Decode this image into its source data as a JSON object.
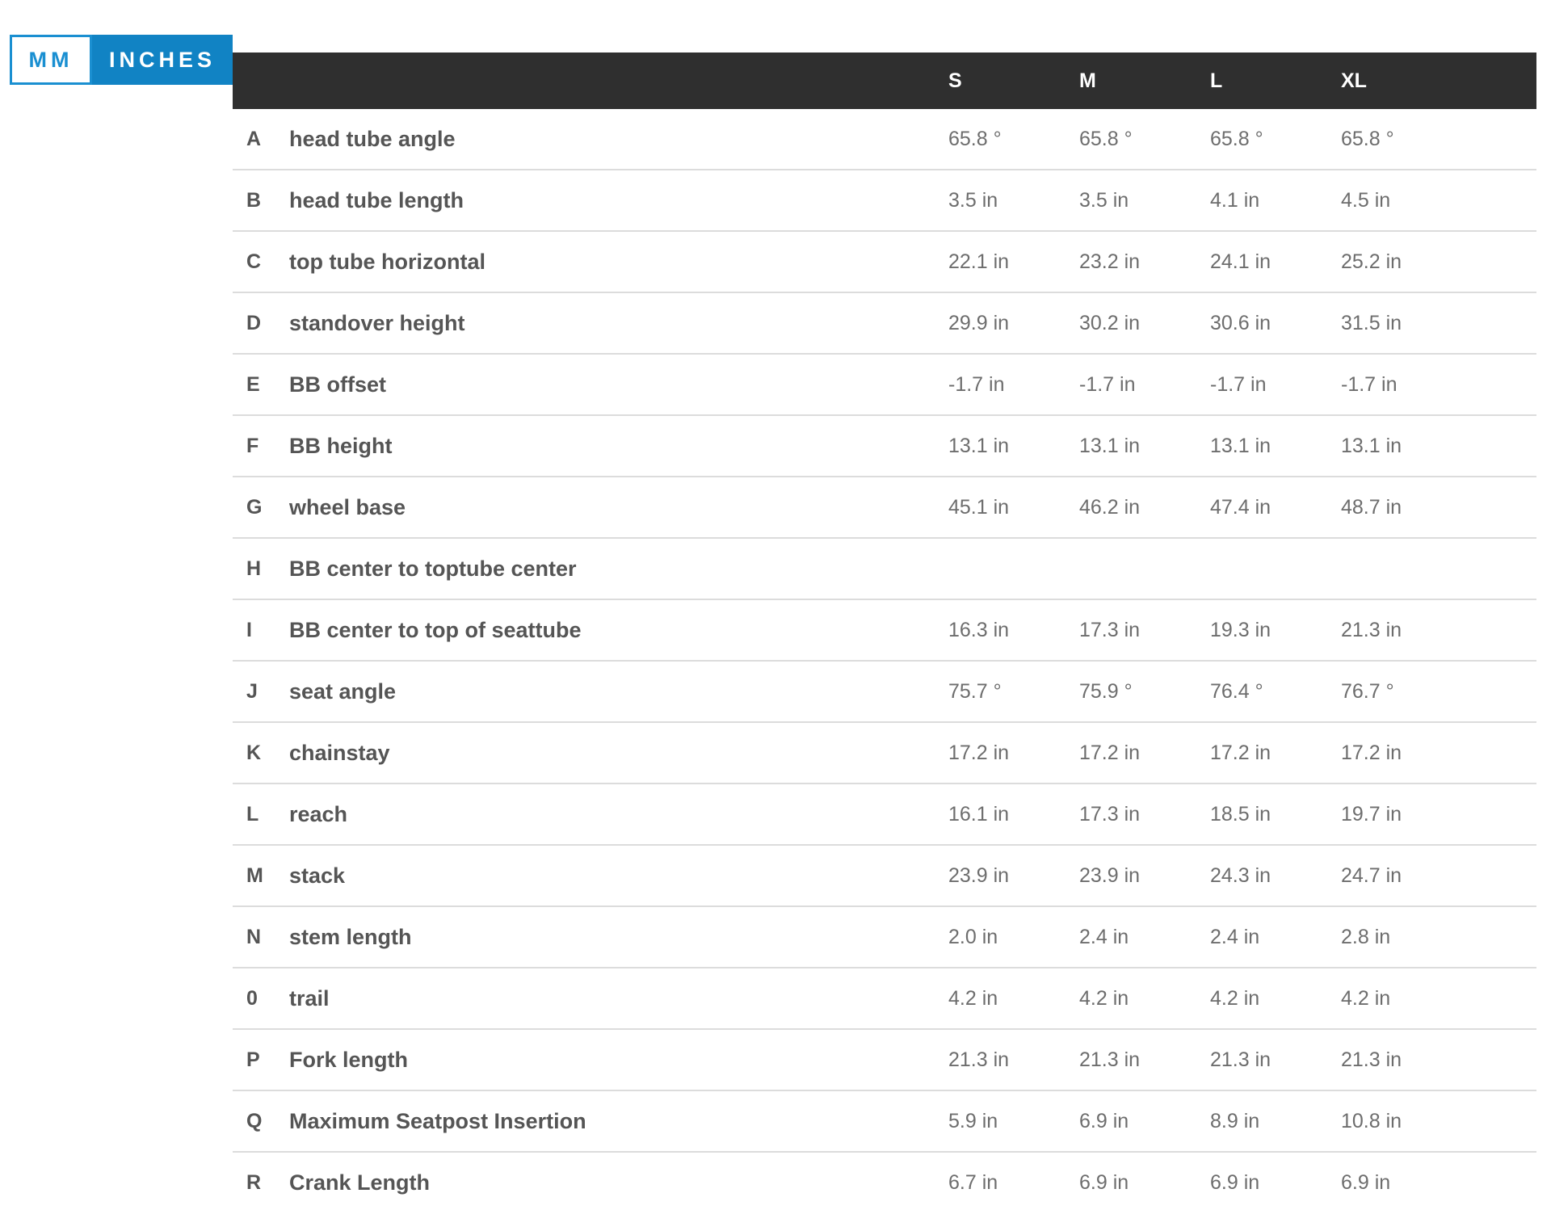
{
  "unit_toggle": {
    "mm_label": "MM",
    "inches_label": "INCHES",
    "active": "INCHES"
  },
  "colors": {
    "accent": "#1183c4",
    "header_bg": "#2f2f2f",
    "text": "#555555",
    "divider": "#dcdcdc"
  },
  "table": {
    "sizes": [
      "S",
      "M",
      "L",
      "XL"
    ],
    "rows": [
      {
        "letter": "A",
        "name": "head tube angle",
        "values": [
          "65.8 °",
          "65.8 °",
          "65.8 °",
          "65.8 °"
        ]
      },
      {
        "letter": "B",
        "name": "head tube length",
        "values": [
          "3.5 in",
          "3.5 in",
          "4.1 in",
          "4.5 in"
        ]
      },
      {
        "letter": "C",
        "name": "top tube horizontal",
        "values": [
          "22.1 in",
          "23.2 in",
          "24.1 in",
          "25.2 in"
        ]
      },
      {
        "letter": "D",
        "name": "standover height",
        "values": [
          "29.9 in",
          "30.2 in",
          "30.6 in",
          "31.5 in"
        ]
      },
      {
        "letter": "E",
        "name": "BB offset",
        "values": [
          "-1.7 in",
          "-1.7 in",
          "-1.7 in",
          "-1.7 in"
        ]
      },
      {
        "letter": "F",
        "name": "BB height",
        "values": [
          "13.1 in",
          "13.1 in",
          "13.1 in",
          "13.1 in"
        ]
      },
      {
        "letter": "G",
        "name": "wheel base",
        "values": [
          "45.1 in",
          "46.2 in",
          "47.4 in",
          "48.7 in"
        ]
      },
      {
        "letter": "H",
        "name": "BB center to toptube center",
        "values": [
          "",
          "",
          "",
          ""
        ]
      },
      {
        "letter": "I",
        "name": "BB center to top of seattube",
        "values": [
          "16.3 in",
          "17.3 in",
          "19.3 in",
          "21.3 in"
        ]
      },
      {
        "letter": "J",
        "name": "seat angle",
        "values": [
          "75.7 °",
          "75.9 °",
          "76.4 °",
          "76.7 °"
        ]
      },
      {
        "letter": "K",
        "name": "chainstay",
        "values": [
          "17.2 in",
          "17.2 in",
          "17.2 in",
          "17.2 in"
        ]
      },
      {
        "letter": "L",
        "name": "reach",
        "values": [
          "16.1 in",
          "17.3 in",
          "18.5 in",
          "19.7 in"
        ]
      },
      {
        "letter": "M",
        "name": "stack",
        "values": [
          "23.9 in",
          "23.9 in",
          "24.3 in",
          "24.7 in"
        ]
      },
      {
        "letter": "N",
        "name": "stem length",
        "values": [
          "2.0 in",
          "2.4 in",
          "2.4 in",
          "2.8 in"
        ]
      },
      {
        "letter": "0",
        "name": "trail",
        "values": [
          "4.2 in",
          "4.2 in",
          "4.2 in",
          "4.2 in"
        ]
      },
      {
        "letter": "P",
        "name": "Fork length",
        "values": [
          "21.3 in",
          "21.3 in",
          "21.3 in",
          "21.3 in"
        ]
      },
      {
        "letter": "Q",
        "name": "Maximum Seatpost Insertion",
        "values": [
          "5.9 in",
          "6.9 in",
          "8.9 in",
          "10.8 in"
        ]
      },
      {
        "letter": "R",
        "name": "Crank Length",
        "values": [
          "6.7 in",
          "6.9 in",
          "6.9 in",
          "6.9 in"
        ]
      }
    ]
  }
}
